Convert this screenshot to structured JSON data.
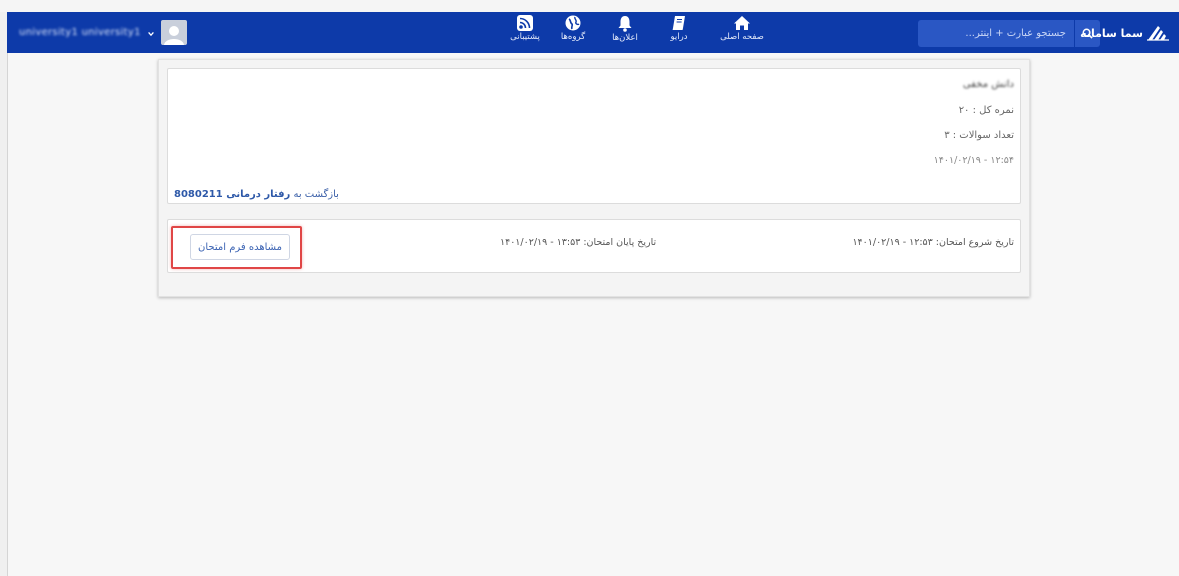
{
  "colors": {
    "navbar": "#0d3aa9",
    "link": "#2d58a8",
    "highlight": "#e04646"
  },
  "brand": {
    "name": "سما سامانه",
    "logo_icon": "sama-logo-icon"
  },
  "search": {
    "placeholder": "جستجو عبارت + اینتر..."
  },
  "nav": {
    "home": {
      "label": "صفحه اصلی",
      "icon": "home-icon"
    },
    "drive": {
      "label": "درایو",
      "icon": "book-icon"
    },
    "announcements": {
      "label": "اعلان‌ها",
      "icon": "bell-icon"
    },
    "groups": {
      "label": "گروه‌ها",
      "icon": "globe-icon"
    },
    "support": {
      "label": "پشتیبانی",
      "icon": "rss-icon"
    }
  },
  "user": {
    "name": "university1 university1"
  },
  "exam": {
    "title": "دانش مخفی",
    "total_score": "نمره کل : ۲۰",
    "question_count": "تعداد سوالات : ۳",
    "created": "۱۲:۵۴ - ۱۴۰۱/۰۲/۱۹",
    "back_prefix": "بازگشت به",
    "course_name": "رفتار درمانی 8080211",
    "start_date": "تاریخ شروع امتحان: ۱۲:۵۳ - ۱۴۰۱/۰۲/۱۹",
    "end_date": "تاریخ پایان امتحان: ۱۳:۵۳ - ۱۴۰۱/۰۲/۱۹",
    "view_button": "مشاهده فرم امتحان"
  }
}
